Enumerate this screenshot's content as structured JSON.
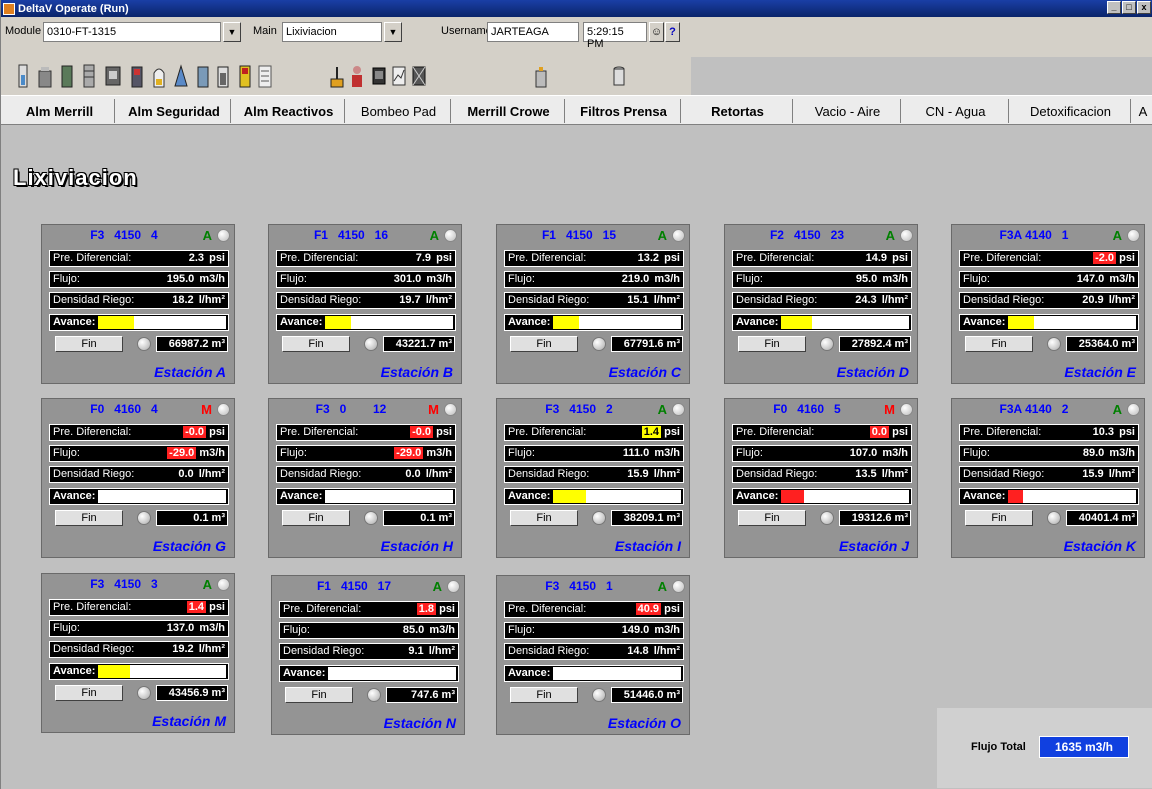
{
  "window": {
    "title": "DeltaV Operate (Run)",
    "buttons": [
      "_",
      "□",
      "x"
    ]
  },
  "modbar": {
    "module_label": "Module",
    "module_value": "0310-FT-1315",
    "main_label": "Main",
    "main_value": "Lixiviacion",
    "username_label": "Username",
    "username_value": "JARTEAGA",
    "time": "5:29:15 PM",
    "help": "?"
  },
  "nav": [
    "Alm Merrill",
    "Alm Seguridad",
    "Alm Reactivos",
    "Bombeo Pad",
    "Merrill Crowe",
    "Filtros Prensa",
    "Retortas",
    "Vacio - Aire",
    "CN - Agua",
    "Detoxificacion",
    "A"
  ],
  "page_title": "Lixiviacion",
  "labels": {
    "pre": "Pre. Diferencial:",
    "flujo": "Flujo:",
    "densidad": "Densidad Riego:",
    "avance": "Avance:",
    "fin": "Fin"
  },
  "stations": [
    {
      "tag": "F3   4150   4",
      "mode": "A",
      "pre": "2.3",
      "pre_unit": "psi",
      "pre_hl": "",
      "flujo": "195.0",
      "flujo_unit": "m3/h",
      "flujo_hl": "",
      "dens": "18.2",
      "dens_unit": "l/hm²",
      "avance": 0.28,
      "avance_color": "#ffff00",
      "total": "66987.2 m³",
      "name": "Estación A"
    },
    {
      "tag": "F1   4150   16",
      "mode": "A",
      "pre": "7.9",
      "pre_unit": "psi",
      "pre_hl": "",
      "flujo": "301.0",
      "flujo_unit": "m3/h",
      "flujo_hl": "",
      "dens": "19.7",
      "dens_unit": "l/hm²",
      "avance": 0.2,
      "avance_color": "#ffff00",
      "total": "43221.7 m³",
      "name": "Estación B"
    },
    {
      "tag": "F1   4150   15",
      "mode": "A",
      "pre": "13.2",
      "pre_unit": "psi",
      "pre_hl": "",
      "flujo": "219.0",
      "flujo_unit": "m3/h",
      "flujo_hl": "",
      "dens": "15.1",
      "dens_unit": "l/hm²",
      "avance": 0.2,
      "avance_color": "#ffff00",
      "total": "67791.6 m³",
      "name": "Estación C"
    },
    {
      "tag": "F2   4150   23",
      "mode": "A",
      "pre": "14.9",
      "pre_unit": "psi",
      "pre_hl": "",
      "flujo": "95.0",
      "flujo_unit": "m3/h",
      "flujo_hl": "",
      "dens": "24.3",
      "dens_unit": "l/hm²",
      "avance": 0.24,
      "avance_color": "#ffff00",
      "total": "27892.4 m³",
      "name": "Estación D"
    },
    {
      "tag": "F3A 4140   1",
      "mode": "A",
      "pre": "-2.0",
      "pre_unit": "psi",
      "pre_hl": "red",
      "flujo": "147.0",
      "flujo_unit": "m3/h",
      "flujo_hl": "",
      "dens": "20.9",
      "dens_unit": "l/hm²",
      "avance": 0.2,
      "avance_color": "#ffff00",
      "total": "25364.0 m³",
      "name": "Estación E"
    },
    {
      "tag": "F0   4160   4",
      "mode": "M",
      "pre": "-0.0",
      "pre_unit": "psi",
      "pre_hl": "red",
      "flujo": "-29.0",
      "flujo_unit": "m3/h",
      "flujo_hl": "red",
      "dens": "0.0",
      "dens_unit": "l/hm²",
      "avance": 0.0,
      "avance_color": "#ffff00",
      "total": "0.1 m³",
      "name": "Estación G"
    },
    {
      "tag": "F3   0        12",
      "mode": "M",
      "pre": "-0.0",
      "pre_unit": "psi",
      "pre_hl": "red",
      "flujo": "-29.0",
      "flujo_unit": "m3/h",
      "flujo_hl": "red",
      "dens": "0.0",
      "dens_unit": "l/hm²",
      "avance": 0.0,
      "avance_color": "#ffff00",
      "total": "0.1 m³",
      "name": "Estación H"
    },
    {
      "tag": "F3   4150   2",
      "mode": "A",
      "pre": "1.4",
      "pre_unit": "psi",
      "pre_hl": "yellow",
      "flujo": "111.0",
      "flujo_unit": "m3/h",
      "flujo_hl": "",
      "dens": "15.9",
      "dens_unit": "l/hm²",
      "avance": 0.26,
      "avance_color": "#ffff00",
      "total": "38209.1 m³",
      "name": "Estación I"
    },
    {
      "tag": "F0   4160   5",
      "mode": "M",
      "pre": "0.0",
      "pre_unit": "psi",
      "pre_hl": "red",
      "flujo": "107.0",
      "flujo_unit": "m3/h",
      "flujo_hl": "",
      "dens": "13.5",
      "dens_unit": "l/hm²",
      "avance": 0.18,
      "avance_color": "#ff2020",
      "total": "19312.6 m³",
      "name": "Estación J"
    },
    {
      "tag": "F3A 4140   2",
      "mode": "A",
      "pre": "10.3",
      "pre_unit": "psi",
      "pre_hl": "",
      "flujo": "89.0",
      "flujo_unit": "m3/h",
      "flujo_hl": "",
      "dens": "15.9",
      "dens_unit": "l/hm²",
      "avance": 0.12,
      "avance_color": "#ff2020",
      "total": "40401.4 m³",
      "name": "Estación K"
    },
    {
      "tag": "F3   4150   3",
      "mode": "A",
      "pre": "1.4",
      "pre_unit": "psi",
      "pre_hl": "red",
      "flujo": "137.0",
      "flujo_unit": "m3/h",
      "flujo_hl": "",
      "dens": "19.2",
      "dens_unit": "l/hm²",
      "avance": 0.25,
      "avance_color": "#ffff00",
      "total": "43456.9 m³",
      "name": "Estación M"
    },
    {
      "tag": "F1   4150   17",
      "mode": "A",
      "pre": "1.8",
      "pre_unit": "psi",
      "pre_hl": "red",
      "flujo": "85.0",
      "flujo_unit": "m3/h",
      "flujo_hl": "",
      "dens": "9.1",
      "dens_unit": "l/hm²",
      "avance": 0.0,
      "avance_color": "#ffff00",
      "total": "747.6 m³",
      "name": "Estación N"
    },
    {
      "tag": "F3   4150   1",
      "mode": "A",
      "pre": "40.9",
      "pre_unit": "psi",
      "pre_hl": "red",
      "flujo": "149.0",
      "flujo_unit": "m3/h",
      "flujo_hl": "",
      "dens": "14.8",
      "dens_unit": "l/hm²",
      "avance": 0.0,
      "avance_color": "#ffff00",
      "total": "51446.0 m³",
      "name": "Estación O"
    }
  ],
  "flujo_total": {
    "label": "Flujo Total",
    "value": "1635 m3/h"
  }
}
